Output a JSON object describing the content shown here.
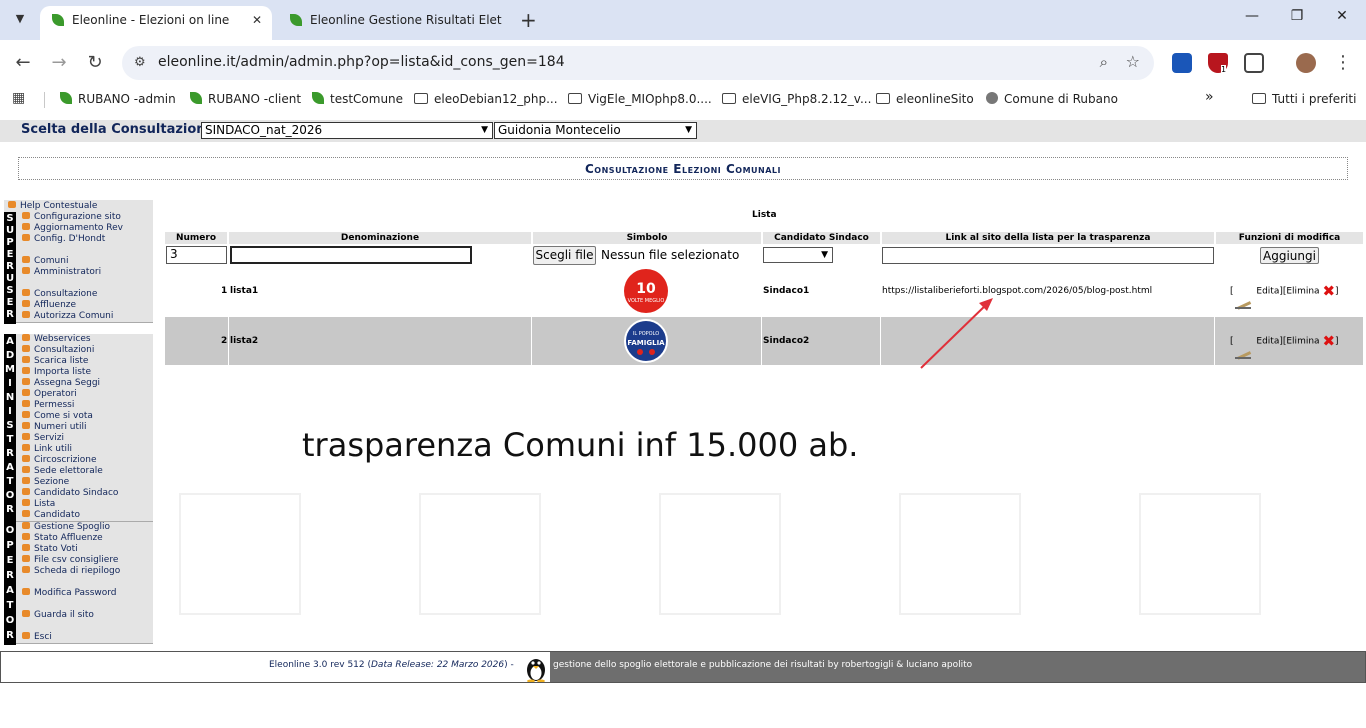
{
  "browser": {
    "tabs": [
      {
        "title": "Eleonline - Elezioni on line",
        "active": true
      },
      {
        "title": "Eleonline Gestione Risultati Elet",
        "active": false
      }
    ],
    "url": "eleonline.it/admin/admin.php?op=lista&id_cons_gen=184",
    "bookmarks": [
      {
        "label": "RUBANO -admin",
        "icon": "leaf-icon"
      },
      {
        "label": "RUBANO -client",
        "icon": "leaf-icon"
      },
      {
        "label": "testComune",
        "icon": "leaf-icon"
      },
      {
        "label": "eleoDebian12_php...",
        "icon": "folder-icon"
      },
      {
        "label": "VigEle_MIOphp8.0....",
        "icon": "folder-icon"
      },
      {
        "label": "eleVIG_Php8.2.12_v...",
        "icon": "folder-icon"
      },
      {
        "label": "eleonlineSito",
        "icon": "folder-icon"
      },
      {
        "label": "Comune di Rubano",
        "icon": "crest-icon"
      }
    ],
    "bookmarks_more": "»",
    "all_bookmarks": "Tutti i preferiti",
    "badge_count": "1"
  },
  "consultazione": {
    "label": "Scelta della Consultazione:",
    "selected_consultazione": "SINDACO_nat_2026",
    "selected_comune": "Guidonia Montecelio"
  },
  "header_title": "Consultazione Elezioni Comunali",
  "sidebar": {
    "help": "Help Contestuale",
    "groups": [
      {
        "vertical": "SUPERUSER",
        "items": [
          "Configurazione sito",
          "Aggiornamento Rev",
          "Config. D'Hondt",
          "Comuni",
          "Amministratori",
          "Consultazione",
          "Affluenze",
          "Autorizza Comuni"
        ]
      },
      {
        "vertical": "ADMINISTRATOR",
        "items": [
          "Webservices",
          "Consultazioni",
          "Scarica liste",
          "Importa liste",
          "Assegna Seggi",
          "Operatori",
          "Permessi",
          "Come si vota",
          "Numeri utili",
          "Servizi",
          "Link utili",
          "Circoscrizione",
          "Sede elettorale",
          "Sezione",
          "Candidato Sindaco",
          "Lista",
          "Candidato"
        ]
      },
      {
        "vertical": "OPERATOR",
        "items": [
          "Gestione Spoglio",
          "Stato Affluenze",
          "Stato Voti",
          "File csv consigliere",
          "Scheda di riepilogo",
          "Modifica Password",
          "Guarda il sito",
          "Esci"
        ]
      }
    ]
  },
  "lista": {
    "title": "Lista",
    "columns": [
      "Numero",
      "Denominazione",
      "Simbolo",
      "Candidato Sindaco",
      "Link al sito della lista per la trasparenza",
      "Funzioni di modifica"
    ],
    "new_row": {
      "numero": "3",
      "denominazione": "",
      "file_button": "Scegli file",
      "file_status": "Nessun file selezionato",
      "add_button": "Aggiungi"
    },
    "rows": [
      {
        "numero": "1",
        "denominazione": "lista1",
        "candidato": "Sindaco1",
        "link": "https://listaliberieforti.blogspot.com/2026/05/blog-post.html",
        "logo_color": "#e0241c",
        "logo_text": "10 VOLTE MEGLIO"
      },
      {
        "numero": "2",
        "denominazione": "lista2",
        "candidato": "Sindaco2",
        "link": "",
        "logo_color": "#1c3c8c",
        "logo_text": "IL POPOLO DELLA FAMIGLIA"
      }
    ],
    "edit_label": "Edita",
    "delete_label": "Elimina"
  },
  "caption": "trasparenza Comuni inf 15.000 ab.",
  "footer": {
    "version": "Eleonline 3.0 rev 512 (",
    "release": "Data Release: 22 Marzo 2026",
    "version_end": ") -",
    "credits": "gestione dello spoglio elettorale e pubblicazione dei risultati by robertogigli & luciano apolito"
  }
}
